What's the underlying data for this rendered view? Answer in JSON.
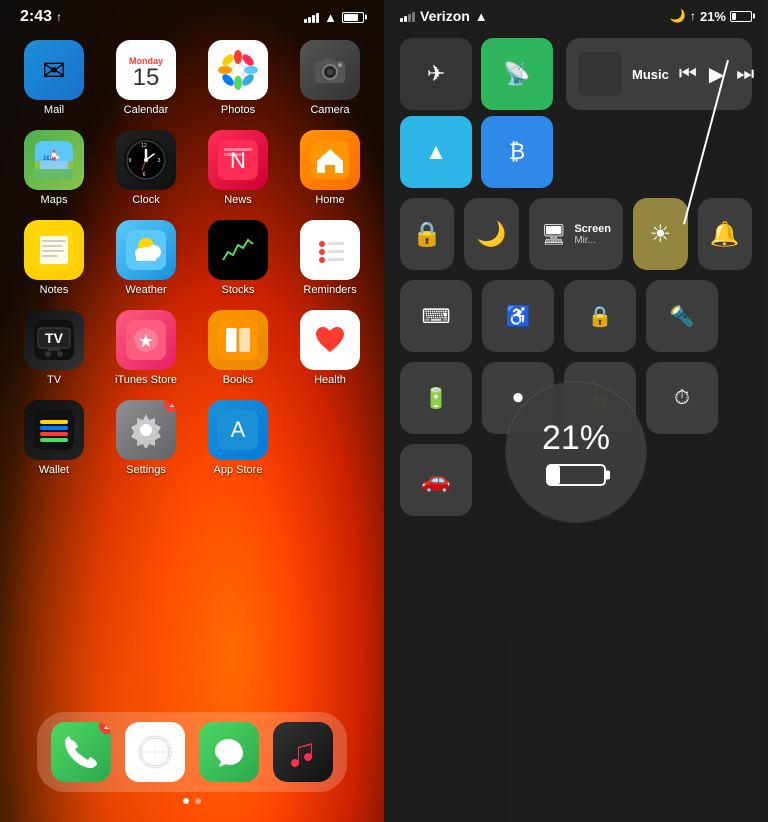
{
  "left": {
    "status": {
      "time": "2:43",
      "location_arrow": "↑"
    },
    "apps_row1": [
      {
        "id": "mail",
        "label": "Mail",
        "icon_type": "mail"
      },
      {
        "id": "calendar",
        "label": "Calendar",
        "icon_type": "calendar",
        "month": "Monday",
        "day": "15"
      },
      {
        "id": "photos",
        "label": "Photos",
        "icon_type": "photos"
      },
      {
        "id": "camera",
        "label": "Camera",
        "icon_type": "camera"
      }
    ],
    "apps_row2": [
      {
        "id": "maps",
        "label": "Maps",
        "icon_type": "maps"
      },
      {
        "id": "clock",
        "label": "Clock",
        "icon_type": "clock"
      },
      {
        "id": "news",
        "label": "News",
        "icon_type": "news"
      },
      {
        "id": "home",
        "label": "Home",
        "icon_type": "home"
      }
    ],
    "apps_row3": [
      {
        "id": "notes",
        "label": "Notes",
        "icon_type": "notes"
      },
      {
        "id": "weather",
        "label": "Weather",
        "icon_type": "weather"
      },
      {
        "id": "stocks",
        "label": "Stocks",
        "icon_type": "stocks"
      },
      {
        "id": "reminders",
        "label": "Reminders",
        "icon_type": "reminders"
      }
    ],
    "apps_row4": [
      {
        "id": "tv",
        "label": "TV",
        "icon_type": "tv"
      },
      {
        "id": "itunes",
        "label": "iTunes Store",
        "icon_type": "itunes"
      },
      {
        "id": "books",
        "label": "Books",
        "icon_type": "books"
      },
      {
        "id": "health",
        "label": "Health",
        "icon_type": "health"
      }
    ],
    "apps_row5": [
      {
        "id": "wallet",
        "label": "Wallet",
        "icon_type": "wallet"
      },
      {
        "id": "settings",
        "label": "Settings",
        "icon_type": "settings",
        "badge": "1"
      },
      {
        "id": "appstore",
        "label": "App Store",
        "icon_type": "appstore"
      },
      {
        "id": "empty",
        "label": "",
        "icon_type": "empty"
      }
    ],
    "dock": [
      {
        "id": "phone",
        "label": "Phone",
        "badge": "2"
      },
      {
        "id": "safari",
        "label": "Safari"
      },
      {
        "id": "messages",
        "label": "Messages"
      },
      {
        "id": "music",
        "label": "Music"
      }
    ]
  },
  "right": {
    "status": {
      "carrier": "Verizon",
      "battery_pct": "21%",
      "battery_num": "21%"
    },
    "controls": {
      "airplane": "✈",
      "cellular": "📶",
      "wifi": "wifi",
      "bluetooth": "bluetooth",
      "music_label": "Music",
      "rewind": "⏮",
      "play": "▶",
      "fastforward": "⏭",
      "rotation_lock": "🔒",
      "do_not_disturb": "🌙",
      "screen_mirror_label": "Screen\nMir...",
      "brightness_label": "☀",
      "volume_label": "🔔",
      "keyboard": "⌨",
      "accessibility": "♿",
      "flashlight": "🔦",
      "battery_low": "🔋",
      "screen_record": "⏺",
      "timer": "⏰",
      "car": "🚗"
    },
    "battery_overlay": {
      "percent": "21%"
    }
  }
}
